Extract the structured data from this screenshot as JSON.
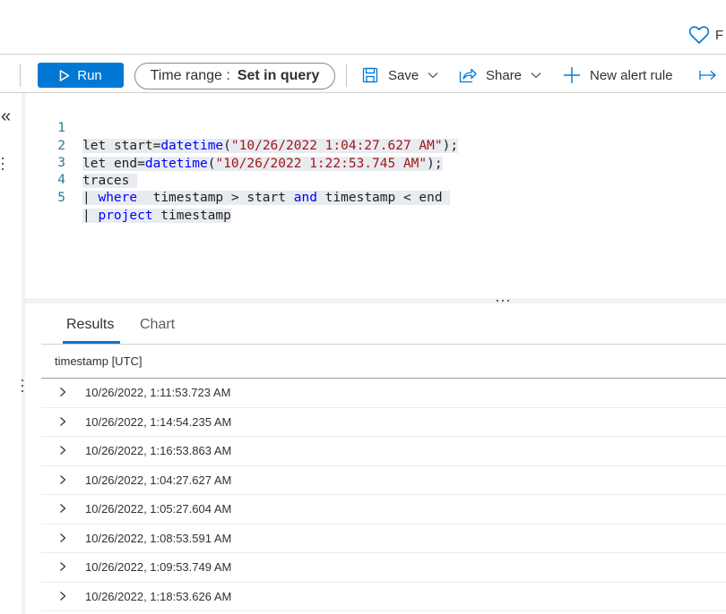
{
  "header": {
    "favorite_label": "F"
  },
  "toolbar": {
    "run_label": "Run",
    "time_range_label": "Time range :",
    "time_range_value": "Set in query",
    "save_label": "Save",
    "share_label": "Share",
    "new_alert_label": "New alert rule"
  },
  "editor": {
    "lines": [
      {
        "number": "1",
        "text": "let start=datetime(\"10/26/2022 1:04:27.627 AM\");"
      },
      {
        "number": "2",
        "text": "let end=datetime(\"10/26/2022 1:22:53.745 AM\");"
      },
      {
        "number": "3",
        "text": "traces"
      },
      {
        "number": "4",
        "text": "| where  timestamp > start and timestamp < end"
      },
      {
        "number": "5",
        "text": "| project timestamp"
      }
    ],
    "tokens": {
      "l1_let": "let",
      "l1_var": "start=",
      "l1_fn": "datetime",
      "l1_open": "(",
      "l1_str": "\"10/26/2022 1:04:27.627 AM\"",
      "l1_close": ");",
      "l2_let": "let",
      "l2_var": "end=",
      "l2_fn": "datetime",
      "l2_open": "(",
      "l2_str": "\"10/26/2022 1:22:53.745 AM\"",
      "l2_close": ");",
      "l3_table": "traces",
      "l4_pipe": "| ",
      "l4_kw": "where",
      "l4_a": "  timestamp > start ",
      "l4_and": "and",
      "l4_b": " timestamp < end ",
      "l5_pipe": "| ",
      "l5_kw": "project",
      "l5_a": " timestamp"
    }
  },
  "results": {
    "tabs": [
      {
        "label": "Results",
        "active": true
      },
      {
        "label": "Chart",
        "active": false
      }
    ],
    "column_header": "timestamp [UTC]",
    "rows": [
      "10/26/2022, 1:11:53.723 AM",
      "10/26/2022, 1:14:54.235 AM",
      "10/26/2022, 1:16:53.863 AM",
      "10/26/2022, 1:04:27.627 AM",
      "10/26/2022, 1:05:27.604 AM",
      "10/26/2022, 1:08:53.591 AM",
      "10/26/2022, 1:09:53.749 AM",
      "10/26/2022, 1:18:53.626 AM"
    ]
  },
  "colors": {
    "accent": "#0078d4",
    "keyword": "#0000ff",
    "string": "#a31515",
    "line_number": "#2b7a93"
  }
}
